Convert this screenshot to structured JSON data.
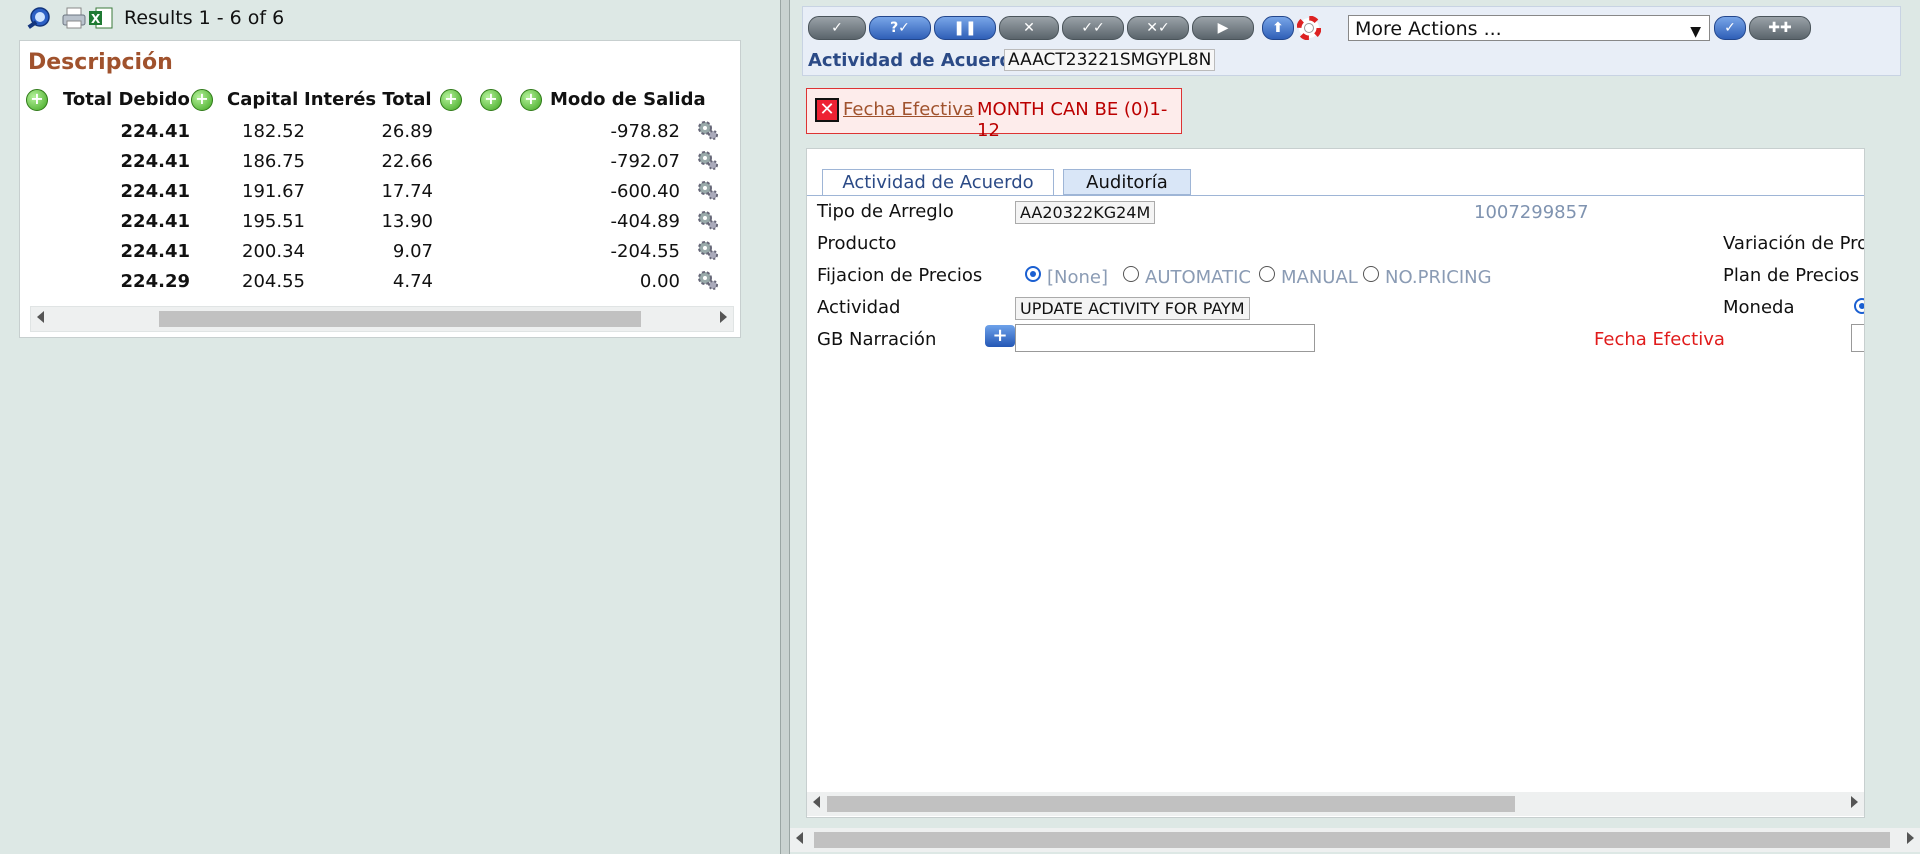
{
  "left": {
    "results_text": "Results 1 - 6 of 6",
    "title": "Descripción",
    "columns": [
      "Total Debido",
      "Capital",
      "Interés Total",
      "Modo de Salida"
    ],
    "rows": [
      {
        "total": "224.41",
        "capital": "182.52",
        "interest": "26.89",
        "mode": "-978.82"
      },
      {
        "total": "224.41",
        "capital": "186.75",
        "interest": "22.66",
        "mode": "-792.07"
      },
      {
        "total": "224.41",
        "capital": "191.67",
        "interest": "17.74",
        "mode": "-600.40"
      },
      {
        "total": "224.41",
        "capital": "195.51",
        "interest": "13.90",
        "mode": "-404.89"
      },
      {
        "total": "224.41",
        "capital": "200.34",
        "interest": "9.07",
        "mode": "-204.55"
      },
      {
        "total": "224.29",
        "capital": "204.55",
        "interest": "4.74",
        "mode": "0.00"
      }
    ]
  },
  "right": {
    "more_actions": "More Actions ...",
    "activity_label": "Actividad de Acuerdo",
    "activity_id": "AAACT23221SMGYPL8N",
    "error": {
      "link": "Fecha Efectiva",
      "message": "MONTH CAN BE (0)1-12"
    },
    "tabs": [
      "Actividad de Acuerdo",
      "Auditoría"
    ],
    "form": {
      "tipo_label": "Tipo de Arreglo",
      "tipo_value": "AA20322KG24M",
      "account_number": "1007299857",
      "producto_label": "Producto",
      "variacion_label": "Variación de Prod",
      "fijacion_label": "Fijacion de Precios",
      "pricing_options": [
        "[None]",
        "AUTOMATIC",
        "MANUAL",
        "NO.PRICING"
      ],
      "plan_label": "Plan de Precios",
      "actividad_label": "Actividad",
      "actividad_value": "UPDATE ACTIVITY FOR PAYM",
      "moneda_label": "Moneda",
      "gb_label": "GB Narración",
      "fecha_label": "Fecha Efectiva"
    }
  }
}
